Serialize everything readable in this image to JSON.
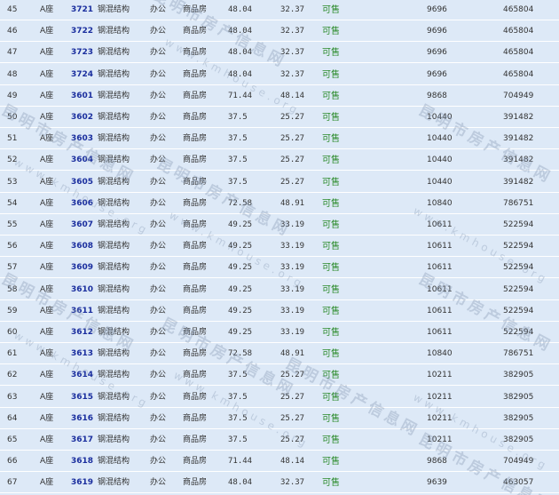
{
  "rows": [
    {
      "idx": "45",
      "building": "A座",
      "room": "3721",
      "structure": "钢混结构",
      "use": "办公",
      "type": "商品房",
      "area": "48.04",
      "inner": "32.37",
      "status": "可售",
      "price": "9696",
      "total": "465804"
    },
    {
      "idx": "46",
      "building": "A座",
      "room": "3722",
      "structure": "钢混结构",
      "use": "办公",
      "type": "商品房",
      "area": "48.04",
      "inner": "32.37",
      "status": "可售",
      "price": "9696",
      "total": "465804"
    },
    {
      "idx": "47",
      "building": "A座",
      "room": "3723",
      "structure": "钢混结构",
      "use": "办公",
      "type": "商品房",
      "area": "48.04",
      "inner": "32.37",
      "status": "可售",
      "price": "9696",
      "total": "465804"
    },
    {
      "idx": "48",
      "building": "A座",
      "room": "3724",
      "structure": "钢混结构",
      "use": "办公",
      "type": "商品房",
      "area": "48.04",
      "inner": "32.37",
      "status": "可售",
      "price": "9696",
      "total": "465804"
    },
    {
      "idx": "49",
      "building": "A座",
      "room": "3601",
      "structure": "钢混结构",
      "use": "办公",
      "type": "商品房",
      "area": "71.44",
      "inner": "48.14",
      "status": "可售",
      "price": "9868",
      "total": "704949"
    },
    {
      "idx": "50",
      "building": "A座",
      "room": "3602",
      "structure": "钢混结构",
      "use": "办公",
      "type": "商品房",
      "area": "37.5",
      "inner": "25.27",
      "status": "可售",
      "price": "10440",
      "total": "391482"
    },
    {
      "idx": "51",
      "building": "A座",
      "room": "3603",
      "structure": "钢混结构",
      "use": "办公",
      "type": "商品房",
      "area": "37.5",
      "inner": "25.27",
      "status": "可售",
      "price": "10440",
      "total": "391482"
    },
    {
      "idx": "52",
      "building": "A座",
      "room": "3604",
      "structure": "钢混结构",
      "use": "办公",
      "type": "商品房",
      "area": "37.5",
      "inner": "25.27",
      "status": "可售",
      "price": "10440",
      "total": "391482"
    },
    {
      "idx": "53",
      "building": "A座",
      "room": "3605",
      "structure": "钢混结构",
      "use": "办公",
      "type": "商品房",
      "area": "37.5",
      "inner": "25.27",
      "status": "可售",
      "price": "10440",
      "total": "391482"
    },
    {
      "idx": "54",
      "building": "A座",
      "room": "3606",
      "structure": "钢混结构",
      "use": "办公",
      "type": "商品房",
      "area": "72.58",
      "inner": "48.91",
      "status": "可售",
      "price": "10840",
      "total": "786751"
    },
    {
      "idx": "55",
      "building": "A座",
      "room": "3607",
      "structure": "钢混结构",
      "use": "办公",
      "type": "商品房",
      "area": "49.25",
      "inner": "33.19",
      "status": "可售",
      "price": "10611",
      "total": "522594"
    },
    {
      "idx": "56",
      "building": "A座",
      "room": "3608",
      "structure": "钢混结构",
      "use": "办公",
      "type": "商品房",
      "area": "49.25",
      "inner": "33.19",
      "status": "可售",
      "price": "10611",
      "total": "522594"
    },
    {
      "idx": "57",
      "building": "A座",
      "room": "3609",
      "structure": "钢混结构",
      "use": "办公",
      "type": "商品房",
      "area": "49.25",
      "inner": "33.19",
      "status": "可售",
      "price": "10611",
      "total": "522594"
    },
    {
      "idx": "58",
      "building": "A座",
      "room": "3610",
      "structure": "钢混结构",
      "use": "办公",
      "type": "商品房",
      "area": "49.25",
      "inner": "33.19",
      "status": "可售",
      "price": "10611",
      "total": "522594"
    },
    {
      "idx": "59",
      "building": "A座",
      "room": "3611",
      "structure": "钢混结构",
      "use": "办公",
      "type": "商品房",
      "area": "49.25",
      "inner": "33.19",
      "status": "可售",
      "price": "10611",
      "total": "522594"
    },
    {
      "idx": "60",
      "building": "A座",
      "room": "3612",
      "structure": "钢混结构",
      "use": "办公",
      "type": "商品房",
      "area": "49.25",
      "inner": "33.19",
      "status": "可售",
      "price": "10611",
      "total": "522594"
    },
    {
      "idx": "61",
      "building": "A座",
      "room": "3613",
      "structure": "钢混结构",
      "use": "办公",
      "type": "商品房",
      "area": "72.58",
      "inner": "48.91",
      "status": "可售",
      "price": "10840",
      "total": "786751"
    },
    {
      "idx": "62",
      "building": "A座",
      "room": "3614",
      "structure": "钢混结构",
      "use": "办公",
      "type": "商品房",
      "area": "37.5",
      "inner": "25.27",
      "status": "可售",
      "price": "10211",
      "total": "382905"
    },
    {
      "idx": "63",
      "building": "A座",
      "room": "3615",
      "structure": "钢混结构",
      "use": "办公",
      "type": "商品房",
      "area": "37.5",
      "inner": "25.27",
      "status": "可售",
      "price": "10211",
      "total": "382905"
    },
    {
      "idx": "64",
      "building": "A座",
      "room": "3616",
      "structure": "钢混结构",
      "use": "办公",
      "type": "商品房",
      "area": "37.5",
      "inner": "25.27",
      "status": "可售",
      "price": "10211",
      "total": "382905"
    },
    {
      "idx": "65",
      "building": "A座",
      "room": "3617",
      "structure": "钢混结构",
      "use": "办公",
      "type": "商品房",
      "area": "37.5",
      "inner": "25.27",
      "status": "可售",
      "price": "10211",
      "total": "382905"
    },
    {
      "idx": "66",
      "building": "A座",
      "room": "3618",
      "structure": "钢混结构",
      "use": "办公",
      "type": "商品房",
      "area": "71.44",
      "inner": "48.14",
      "status": "可售",
      "price": "9868",
      "total": "704949"
    },
    {
      "idx": "67",
      "building": "A座",
      "room": "3619",
      "structure": "钢混结构",
      "use": "办公",
      "type": "商品房",
      "area": "48.04",
      "inner": "32.37",
      "status": "可售",
      "price": "9639",
      "total": "463057"
    }
  ],
  "watermark": {
    "cn": "昆明市房产信息网",
    "en": "www.kmhouse.org"
  },
  "colors": {
    "background": "#dde9f7",
    "room_link": "#1a2e9e",
    "status_available": "#2a8a2a",
    "watermark": "#8296af"
  }
}
